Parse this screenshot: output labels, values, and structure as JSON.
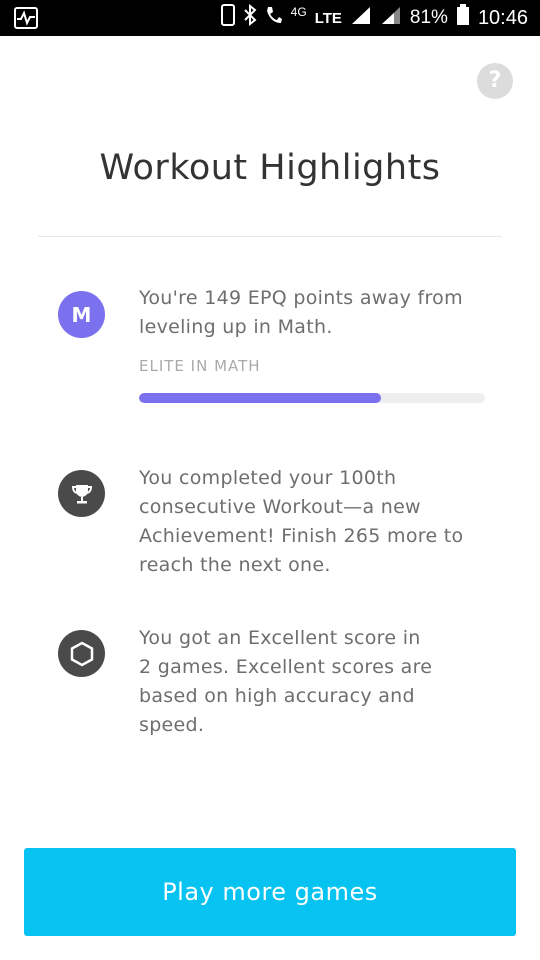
{
  "status_bar": {
    "network": "4G",
    "carrier_tech": "LTE",
    "battery": "81%",
    "time": "10:46"
  },
  "header": {
    "help_label": "?",
    "title": "Workout Highlights"
  },
  "highlights": {
    "level": {
      "icon_letter": "M",
      "text": "You're 149 EPQ points away from leveling up in Math.",
      "level_label": "ELITE IN MATH",
      "progress_fraction": 0.7,
      "accent_color": "#7b71ee"
    },
    "achievement": {
      "icon": "trophy-icon",
      "text": "You completed your 100th consecutive Workout—a new Achievement! Finish 265 more to reach the next one."
    },
    "excellent": {
      "icon": "hexagon-icon",
      "text": "You got an Excellent score in 2 games. Excellent scores are based on high accuracy and speed."
    }
  },
  "cta": {
    "label": "Play more games",
    "color": "#06c3f1"
  }
}
